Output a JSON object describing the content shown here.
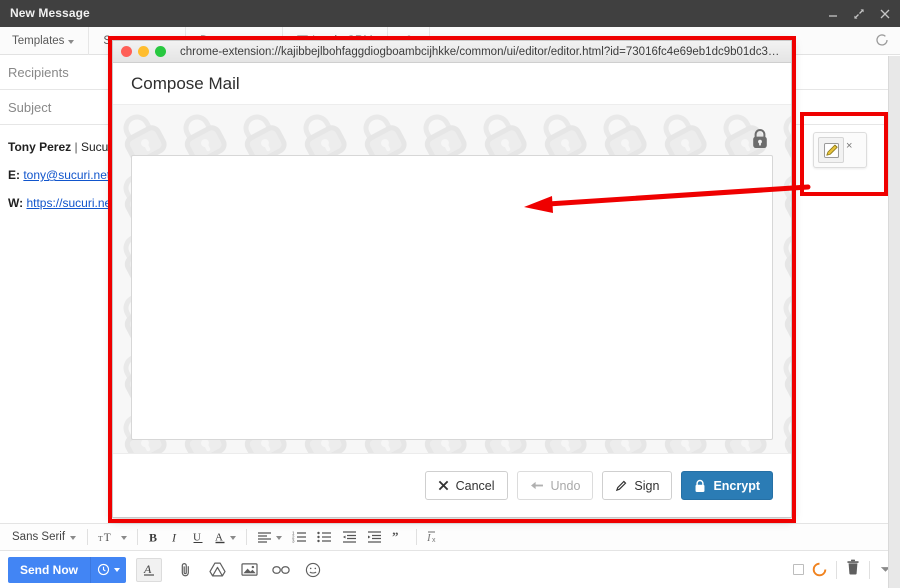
{
  "window": {
    "title": "New Message",
    "controls": [
      {
        "name": "minimize",
        "glyph": "minimize-icon"
      },
      {
        "name": "popout",
        "glyph": "popout-icon"
      },
      {
        "name": "close",
        "glyph": "close-icon"
      }
    ]
  },
  "app_toolbar": {
    "items": [
      {
        "label": "Templates",
        "icon": "chevron-down-icon"
      },
      {
        "label": "Sequences",
        "icon": "chevron-down-icon"
      },
      {
        "label": "Documents",
        "icon": "chevron-down-icon"
      },
      {
        "label": "Log in CRM",
        "icon": "checkbox-icon"
      },
      {
        "label": "",
        "icon": "gear-icon"
      }
    ],
    "reload_icon": "reload-icon"
  },
  "compose_fields": {
    "recipients_placeholder": "Recipients",
    "subject_placeholder": "Subject"
  },
  "signature": {
    "line1_name": "Tony Perez",
    "line1_sep": " | ",
    "line1_company": "Sucuri",
    "line2_label": "E: ",
    "line2_email": "tony@sucuri.net",
    "line2_tail": " |",
    "line3_label": "W: ",
    "line3_site": "https://sucuri.net"
  },
  "format_toolbar": {
    "font_name": "Sans Serif",
    "items": [
      {
        "name": "font-family-selector",
        "label": "Sans Serif",
        "icon": "chevron-down-icon"
      },
      {
        "name": "font-size-selector",
        "label": "",
        "icon": "text-size-icon"
      },
      {
        "name": "bold-button",
        "label": "B",
        "icon": "bold-icon"
      },
      {
        "name": "italic-button",
        "label": "I",
        "icon": "italic-icon"
      },
      {
        "name": "underline-button",
        "label": "U",
        "icon": "underline-icon"
      },
      {
        "name": "text-color-button",
        "label": "A",
        "icon": "text-color-icon"
      },
      {
        "name": "align-button",
        "label": "",
        "icon": "align-left-icon"
      },
      {
        "name": "numbered-list-button",
        "label": "",
        "icon": "numbered-list-icon"
      },
      {
        "name": "bulleted-list-button",
        "label": "",
        "icon": "bulleted-list-icon"
      },
      {
        "name": "indent-less-button",
        "label": "",
        "icon": "indent-decrease-icon"
      },
      {
        "name": "indent-more-button",
        "label": "",
        "icon": "indent-increase-icon"
      },
      {
        "name": "quote-button",
        "label": "",
        "icon": "blockquote-icon"
      },
      {
        "name": "remove-format-button",
        "label": "",
        "icon": "remove-formatting-icon"
      }
    ]
  },
  "bottom_bar": {
    "send_label": "Send Now",
    "schedule_icon": "clock-icon",
    "schedule_caret": "chevron-down-icon",
    "left_icons": [
      {
        "name": "formatting-options-button",
        "icon": "format-text-icon"
      },
      {
        "name": "attach-file-button",
        "icon": "paperclip-icon"
      },
      {
        "name": "insert-drive-button",
        "icon": "google-drive-icon"
      },
      {
        "name": "insert-photo-button",
        "icon": "image-icon"
      },
      {
        "name": "insert-link-button",
        "icon": "link-icon"
      },
      {
        "name": "insert-emoji-button",
        "icon": "emoji-icon"
      }
    ],
    "right_icons": [
      {
        "name": "tracking-checkbox",
        "icon": "checkbox-icon"
      },
      {
        "name": "tracking-indicator",
        "icon": "orange-circle-icon",
        "color": "#f0821e"
      },
      {
        "name": "discard-draft-button",
        "icon": "trash-icon"
      },
      {
        "name": "more-options-button",
        "icon": "chevron-down-icon"
      }
    ]
  },
  "extension_window": {
    "traffic_lights": [
      {
        "name": "close",
        "color": "#ff5f57"
      },
      {
        "name": "minimize",
        "color": "#ffbd2e"
      },
      {
        "name": "maximize",
        "color": "#28c840"
      }
    ],
    "url": "chrome-extension://kajibbejlbohfaggdiogboambcijhkke/common/ui/editor/editor.html?id=73016fc4e69eb1dc9b01dc3&…",
    "heading": "Compose Mail",
    "lock_icon": "padlock-icon",
    "editor_value": "",
    "buttons": [
      {
        "name": "cancel-button",
        "label": "Cancel",
        "icon": "x-icon",
        "style": "default"
      },
      {
        "name": "undo-button",
        "label": "Undo",
        "icon": "arrow-left-icon",
        "style": "muted"
      },
      {
        "name": "sign-button",
        "label": "Sign",
        "icon": "pencil-icon",
        "style": "default"
      },
      {
        "name": "encrypt-button",
        "label": "Encrypt",
        "icon": "lock-icon",
        "style": "primary"
      }
    ]
  },
  "launcher": {
    "compose_icon": "pencil-compose-icon",
    "close_label": "×"
  },
  "annotation": {
    "color": "#ef0000",
    "arrow": "left-arrow"
  }
}
